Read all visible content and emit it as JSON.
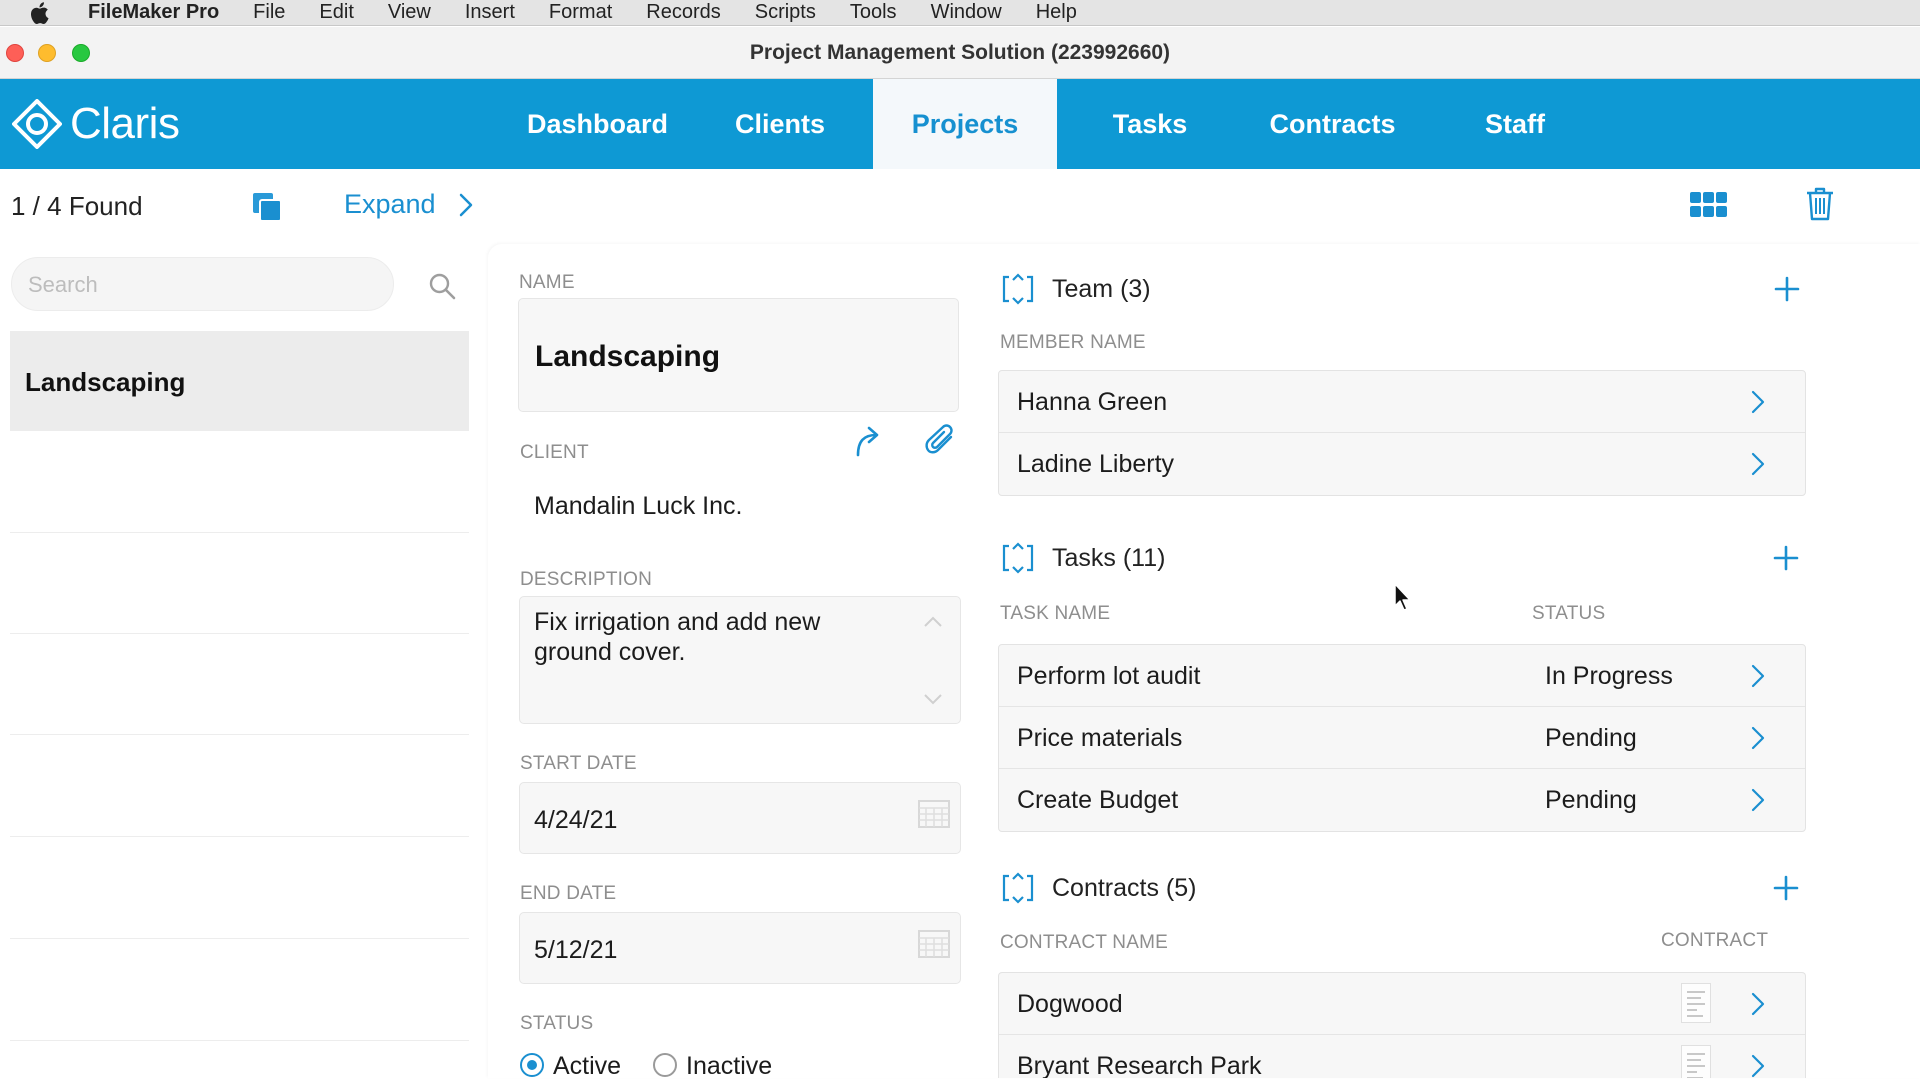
{
  "menubar": {
    "items": [
      "FileMaker Pro",
      "File",
      "Edit",
      "View",
      "Insert",
      "Format",
      "Records",
      "Scripts",
      "Tools",
      "Window",
      "Help"
    ]
  },
  "window": {
    "title": "Project Management Solution (223992660)"
  },
  "nav": {
    "logo": "Claris",
    "tabs": [
      "Dashboard",
      "Clients",
      "Projects",
      "Tasks",
      "Contracts",
      "Staff"
    ],
    "active_tab": "Projects"
  },
  "toolbar": {
    "found": "1 / 4 Found",
    "expand": "Expand"
  },
  "search": {
    "placeholder": "Search"
  },
  "list": {
    "selected": "Landscaping"
  },
  "record": {
    "name_label": "NAME",
    "name": "Landscaping",
    "client_label": "CLIENT",
    "client": "Mandalin Luck Inc.",
    "description_label": "DESCRIPTION",
    "description": "Fix irrigation and add new ground cover.",
    "start_date_label": "START DATE",
    "start_date": "4/24/21",
    "end_date_label": "END DATE",
    "end_date": "5/12/21",
    "status_label": "STATUS",
    "status_options": [
      "Active",
      "Inactive"
    ],
    "status_selected": "Active"
  },
  "team": {
    "title": "Team (3)",
    "col_member": "MEMBER NAME",
    "rows": [
      "Hanna Green",
      "Ladine Liberty"
    ]
  },
  "tasks": {
    "title": "Tasks (11)",
    "col_task": "TASK NAME",
    "col_status": "STATUS",
    "rows": [
      {
        "name": "Perform lot audit",
        "status": "In Progress"
      },
      {
        "name": "Price materials",
        "status": "Pending"
      },
      {
        "name": "Create Budget",
        "status": "Pending"
      }
    ]
  },
  "contracts": {
    "title": "Contracts (5)",
    "col_name": "CONTRACT NAME",
    "col_contract": "CONTRACT",
    "rows": [
      "Dogwood",
      "Bryant Research Park"
    ]
  },
  "colors": {
    "nav_blue": "#0e99d4",
    "accent": "#1a8fd0"
  }
}
